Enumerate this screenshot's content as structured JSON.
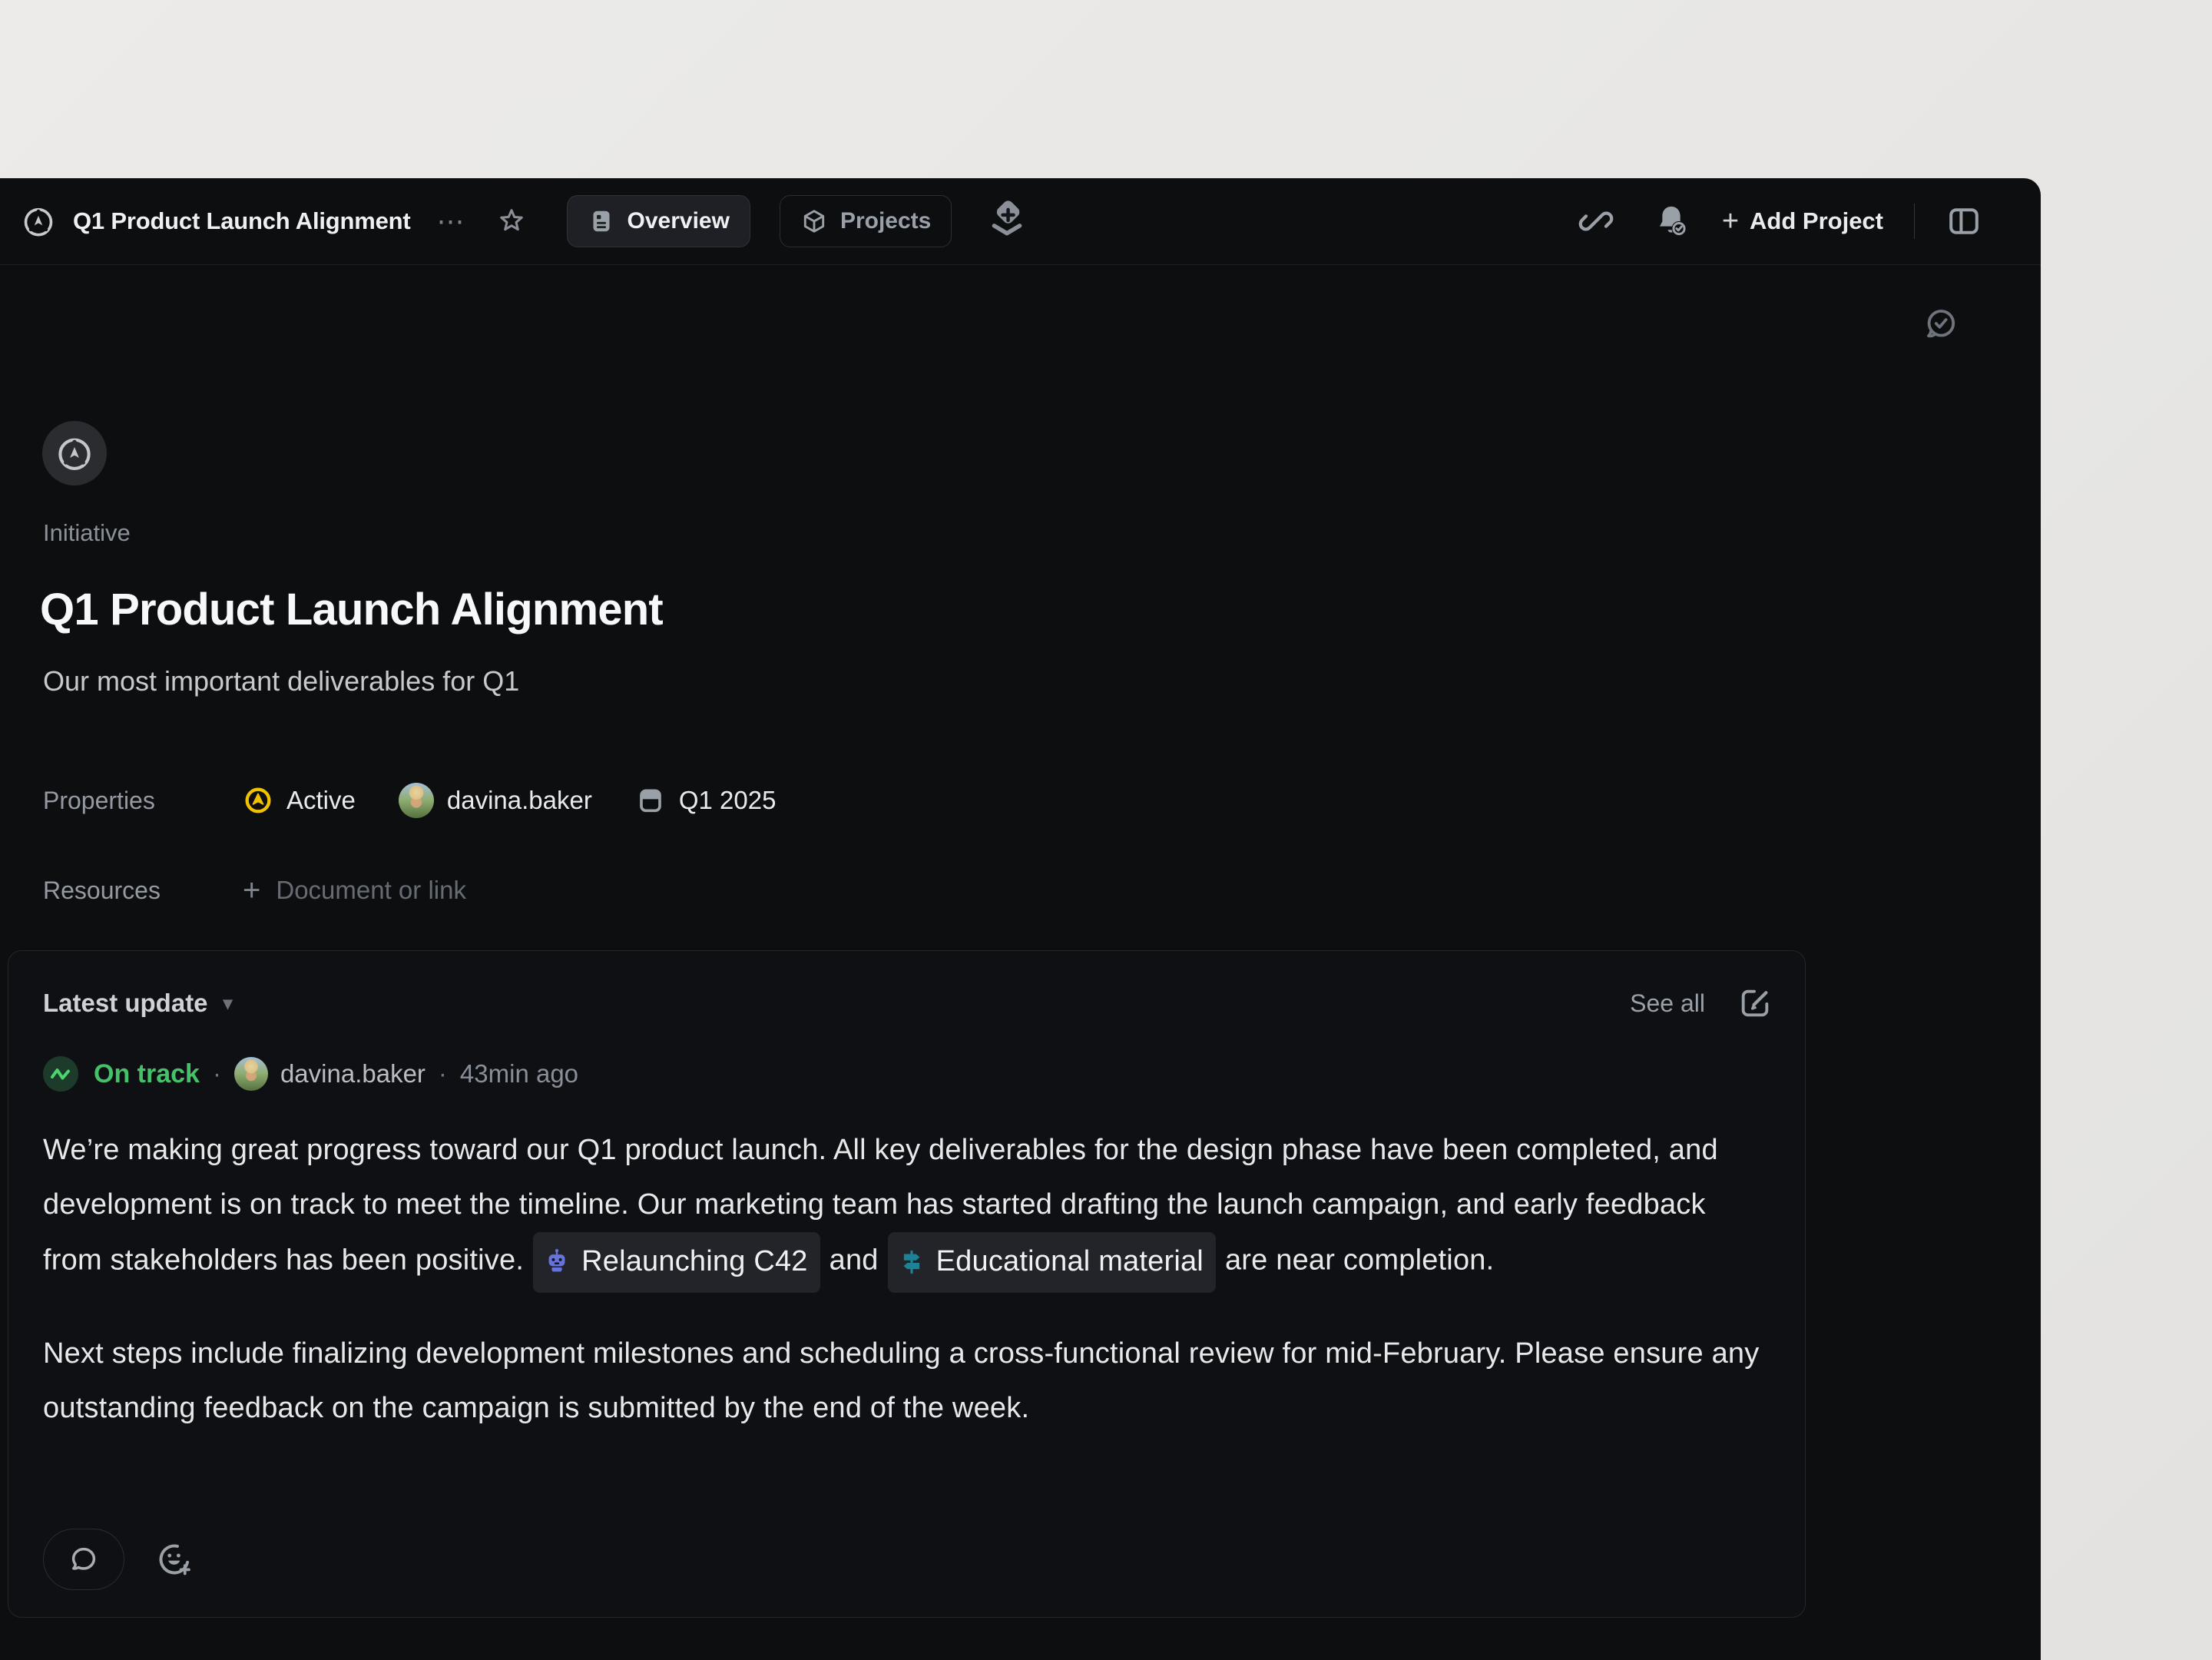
{
  "colors": {
    "backdrop": "#e9e8e6",
    "app_bg": "#0d0e10",
    "card_bg": "#0f1013",
    "card_border": "#24262b",
    "status_active_yellow": "#f2c100",
    "status_ontrack_green": "#45c269",
    "mention_indigo": "#6673dd",
    "mention_teal": "#1d8296",
    "chip_bg": "#232429"
  },
  "icons": {
    "ellipsis": "⋯",
    "dropdown_arrow": "▾",
    "dot_separator": "·",
    "plus": "+"
  },
  "header": {
    "breadcrumb_title": "Q1 Product Launch Alignment",
    "tabs": [
      {
        "label": "Overview",
        "active": true
      },
      {
        "label": "Projects",
        "active": false
      }
    ],
    "add_project_label": "Add Project"
  },
  "main": {
    "type_label": "Initiative",
    "title": "Q1 Product Launch Alignment",
    "description": "Our most important deliverables for Q1",
    "properties_label": "Properties",
    "status_label": "Active",
    "owner_name": "davina.baker",
    "target_label": "Q1 2025",
    "resources_label": "Resources",
    "add_resource_label": "Document or link"
  },
  "update": {
    "title": "Latest update",
    "see_all_label": "See all",
    "status_label": "On track",
    "author": "davina.baker",
    "timestamp": "43min ago",
    "p1_before": "We’re making great progress toward our Q1 product launch. All key deliverables for the design phase have been completed, and development is on track to meet the timeline. Our marketing team has started drafting the launch campaign, and early feedback from stakeholders has been positive.",
    "chip1_label": "Relaunching C42",
    "p1_middle": "and",
    "chip2_label": "Educational material",
    "p1_after": "are near completion.",
    "p2": "Next steps include finalizing development milestones and scheduling a cross-functional review for mid-February. Please ensure any outstanding feedback on the campaign is submitted by the end of the week."
  }
}
